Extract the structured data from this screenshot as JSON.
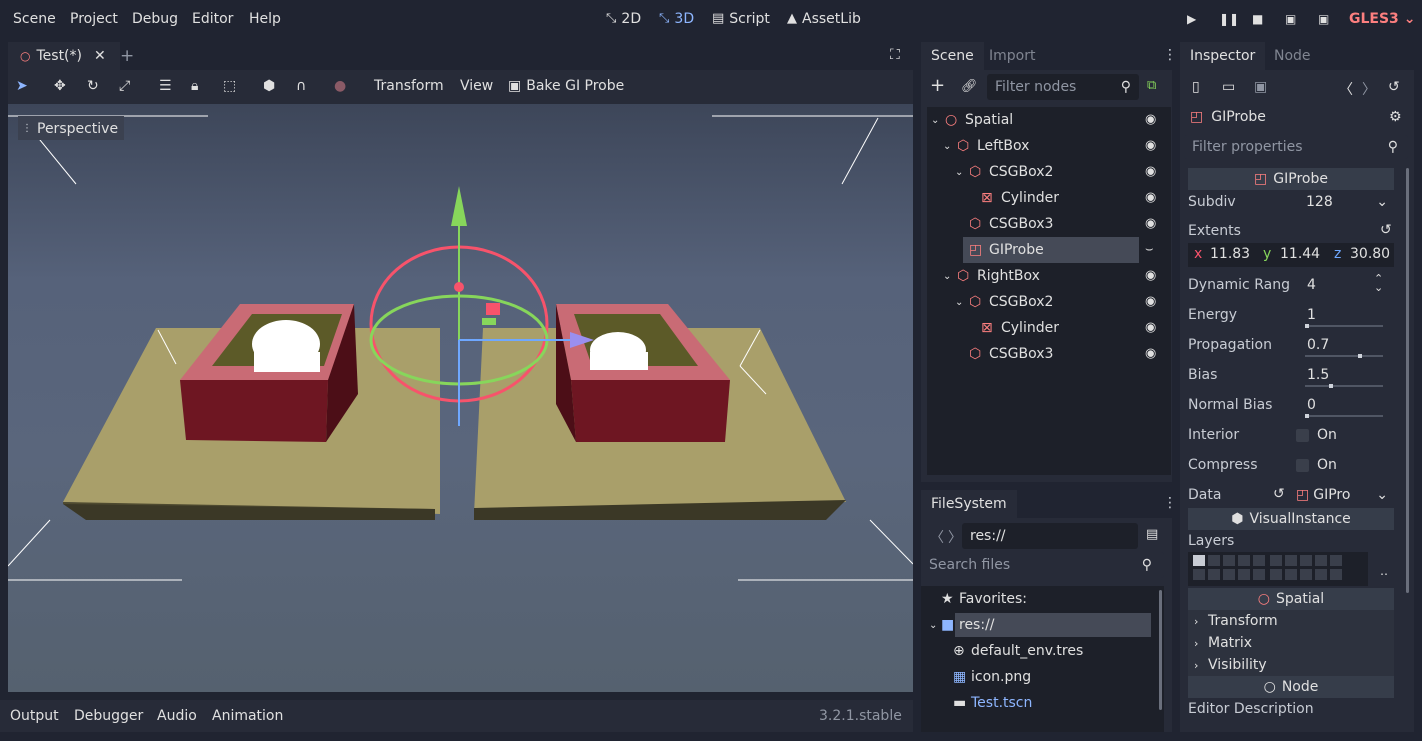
{
  "menus": [
    "Scene",
    "Project",
    "Debug",
    "Editor",
    "Help"
  ],
  "modes": {
    "2d": "2D",
    "3d": "3D",
    "script": "Script",
    "assetlib": "AssetLib"
  },
  "renderer": "GLES3",
  "colors": {
    "accent": "#8eb6ff",
    "background": "#202431",
    "panel": "#272b38",
    "node_red": "#fc7f7f",
    "gizmo_x": "#f7536b",
    "gizmo_y": "#87d65b",
    "gizmo_z": "#6fa8ff"
  },
  "editor": {
    "tab_title": "Test(*)",
    "toolbar": {
      "transform": "Transform",
      "view": "View",
      "bake": "Bake GI Probe"
    },
    "viewport_label": "Perspective"
  },
  "bottom": {
    "tabs": [
      "Output",
      "Debugger",
      "Audio",
      "Animation"
    ],
    "version": "3.2.1.stable"
  },
  "scene_dock": {
    "tabs": [
      "Scene",
      "Import"
    ],
    "filter_placeholder": "Filter nodes",
    "nodes": [
      {
        "name": "Spatial",
        "icon": "spatial-icon"
      },
      {
        "name": "LeftBox",
        "icon": "csg-box-icon"
      },
      {
        "name": "CSGBox2",
        "icon": "csg-box-icon"
      },
      {
        "name": "Cylinder",
        "icon": "csg-cylinder-icon"
      },
      {
        "name": "CSGBox3",
        "icon": "csg-box-icon"
      },
      {
        "name": "GIProbe",
        "icon": "giprobe-icon"
      },
      {
        "name": "RightBox",
        "icon": "csg-box-icon"
      },
      {
        "name": "CSGBox2",
        "icon": "csg-box-icon"
      },
      {
        "name": "Cylinder",
        "icon": "csg-cylinder-icon"
      },
      {
        "name": "CSGBox3",
        "icon": "csg-box-icon"
      }
    ]
  },
  "filesystem": {
    "tab": "FileSystem",
    "path": "res://",
    "search_placeholder": "Search files",
    "favorites": "Favorites:",
    "root": "res://",
    "files": [
      "default_env.tres",
      "icon.png",
      "Test.tscn"
    ]
  },
  "inspector": {
    "tabs": [
      "Inspector",
      "Node"
    ],
    "object": "GIProbe",
    "filter_placeholder": "Filter properties",
    "section_giprobe": "GIProbe",
    "subdiv_label": "Subdiv",
    "subdiv": "128",
    "extents_label": "Extents",
    "extents": {
      "x_label": "x",
      "x": "11.83",
      "y_label": "y",
      "y": "11.44",
      "z_label": "z",
      "z": "30.80"
    },
    "dynamic_range_label": "Dynamic Rang",
    "dynamic_range": "4",
    "energy_label": "Energy",
    "energy": "1",
    "propagation_label": "Propagation",
    "propagation": "0.7",
    "bias_label": "Bias",
    "bias": "1.5",
    "normal_bias_label": "Normal Bias",
    "normal_bias": "0",
    "interior_label": "Interior",
    "interior": "On",
    "compress_label": "Compress",
    "compress": "On",
    "data_label": "Data",
    "data": "GIPro",
    "section_visual": "VisualInstance",
    "layers_label": "Layers",
    "section_spatial": "Spatial",
    "groups": [
      "Transform",
      "Matrix",
      "Visibility"
    ],
    "section_node": "Node",
    "editor_description": "Editor Description"
  }
}
